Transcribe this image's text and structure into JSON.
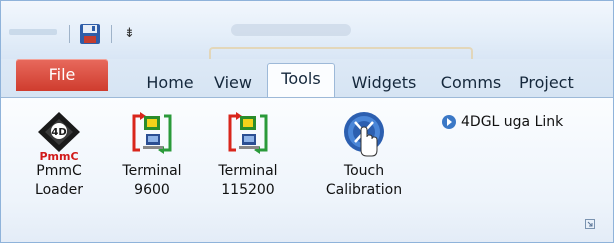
{
  "quick_access": {
    "dropdown_glyph": "⇟",
    "save_icon": "save-disk-icon"
  },
  "tabs": {
    "file": "File",
    "home": "Home",
    "view": "View",
    "tools": "Tools",
    "widgets": "Widgets",
    "comms": "Comms",
    "project": "Project"
  },
  "ribbon": {
    "pmmc": {
      "icon_text": "PmmC",
      "line1": "PmmC",
      "line2": "Loader"
    },
    "terminal_9600": {
      "line1": "Terminal",
      "line2": "9600"
    },
    "terminal_115200": {
      "line1": "Terminal",
      "line2": "115200"
    },
    "touch": {
      "line1": "Touch",
      "line2": "Calibration"
    },
    "link": {
      "label": "4DGL uga Link"
    }
  },
  "colors": {
    "file_tab": "#d9473a",
    "accent_blue": "#3b78c6"
  }
}
